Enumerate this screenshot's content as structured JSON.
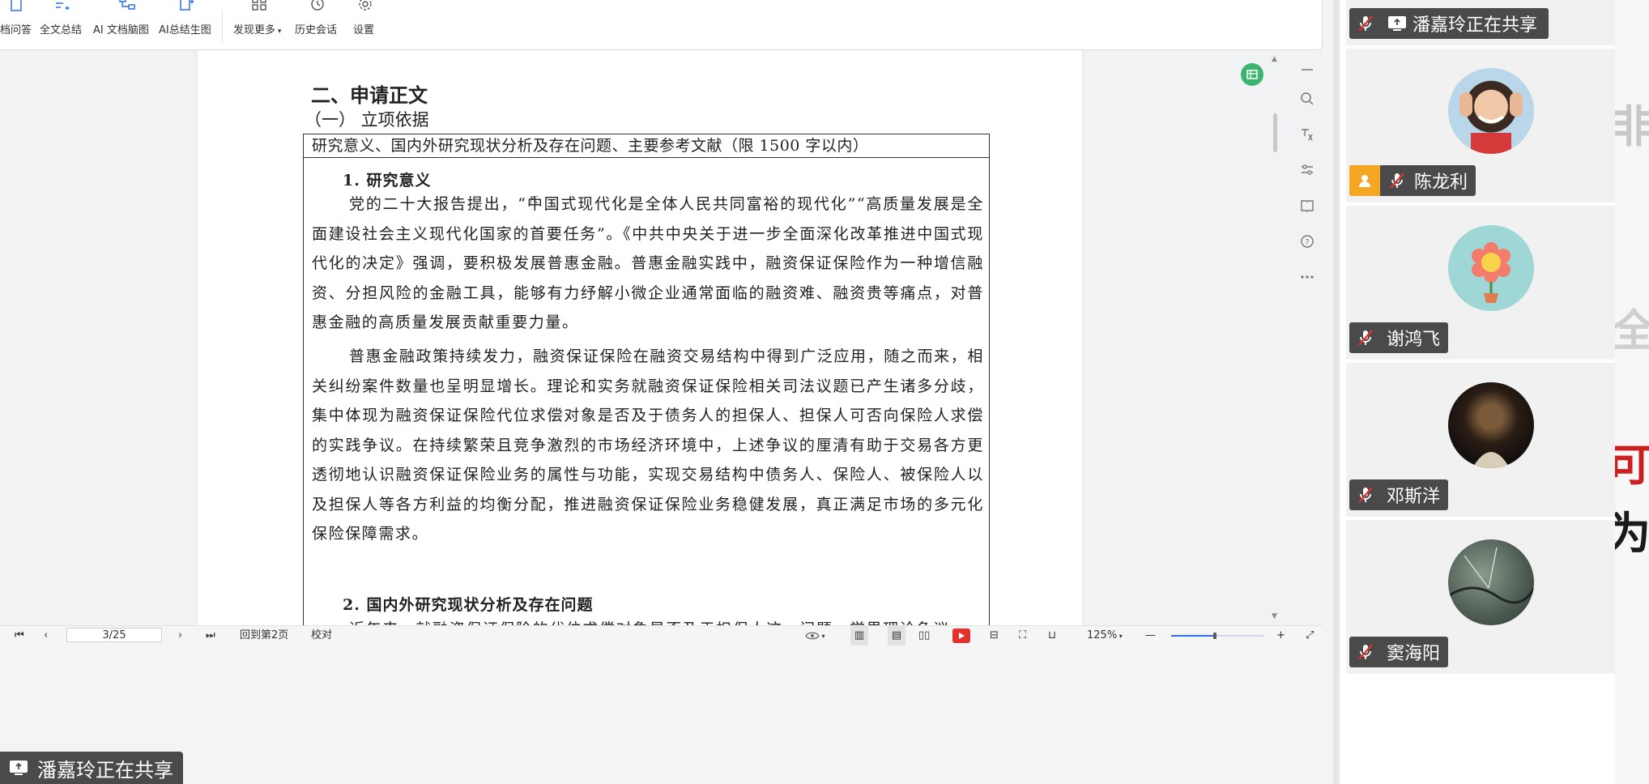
{
  "toolbar": {
    "items": [
      {
        "label": "档问答",
        "icon": "sparkle-doc-icon"
      },
      {
        "label": "全文总结",
        "icon": "summary-icon"
      },
      {
        "label": "AI 文档脑图",
        "icon": "mindmap-icon"
      },
      {
        "label": "AI总结生图",
        "icon": "image-gen-icon"
      },
      {
        "label": "发现更多",
        "icon": "grid-icon"
      },
      {
        "label": "历史会话",
        "icon": "history-icon"
      },
      {
        "label": "设置",
        "icon": "gear-icon"
      }
    ]
  },
  "document": {
    "heading": "二、申请正文",
    "subheading": "（一）  立项依据",
    "box_header": "研究意义、国内外研究现状分析及存在问题、主要参考文献（限 1500 字以内）",
    "section1_title": "1.   研究意义",
    "para1": "党的二十大报告提出，“中国式现代化是全体人民共同富裕的现代化”“高质量发展是全面建设社会主义现代化国家的首要任务”。《中共中央关于进一步全面深化改革推进中国式现代化的决定》强调，要积极发展普惠金融。普惠金融实践中，融资保证保险作为一种增信融资、分担风险的金融工具，能够有力纾解小微企业通常面临的融资难、融资贵等痛点，对普惠金融的高质量发展贡献重要力量。",
    "para2": "普惠金融政策持续发力，融资保证保险在融资交易结构中得到广泛应用，随之而来，相关纠纷案件数量也呈明显增长。理论和实务就融资保证保险相关司法议题已产生诸多分歧，集中体现为融资保证保险代位求偿对象是否及于债务人的担保人、担保人可否向保险人求偿的实践争议。在持续繁荣且竞争激烈的市场经济环境中，上述争议的厘清有助于交易各方更透彻地认识融资保证保险业务的属性与功能，实现交易结构中债务人、保险人、被保险人以及担保人等各方利益的均衡分配，推进融资保证保险业务稳健发展，真正满足市场的多元化保险保障需求。",
    "section2_title": "2.   国内外研究现状分析及存在问题",
    "para3": "近年来，就融资保证保险的代位求偿对象是否及于担保人这一问题，学界理论争议"
  },
  "statusbar": {
    "page_value": "3/25",
    "back_to_page": "回到第2页",
    "proofread": "校对",
    "zoom": "125%",
    "zoom_level": 0.47
  },
  "share_banner": "潘嘉玲正在共享",
  "panel": {
    "top_banner": "潘嘉玲正在共享",
    "participants": [
      {
        "name": "陈龙利",
        "host": true,
        "muted": true,
        "avatar": "avatar-photo-smiling"
      },
      {
        "name": "谢鸿飞",
        "host": false,
        "muted": true,
        "avatar": "avatar-flower"
      },
      {
        "name": "邓斯洋",
        "host": false,
        "muted": true,
        "avatar": "avatar-dark-photo"
      },
      {
        "name": "窦海阳",
        "host": false,
        "muted": true,
        "avatar": "avatar-landscape"
      }
    ]
  },
  "sliver": {
    "chars": [
      "非",
      "全",
      "可打",
      "为任"
    ]
  },
  "colors": {
    "accent": "#2f6fed",
    "host_badge": "#f5a623",
    "record_red": "#e0312d",
    "sheet_green": "#3cb371"
  }
}
